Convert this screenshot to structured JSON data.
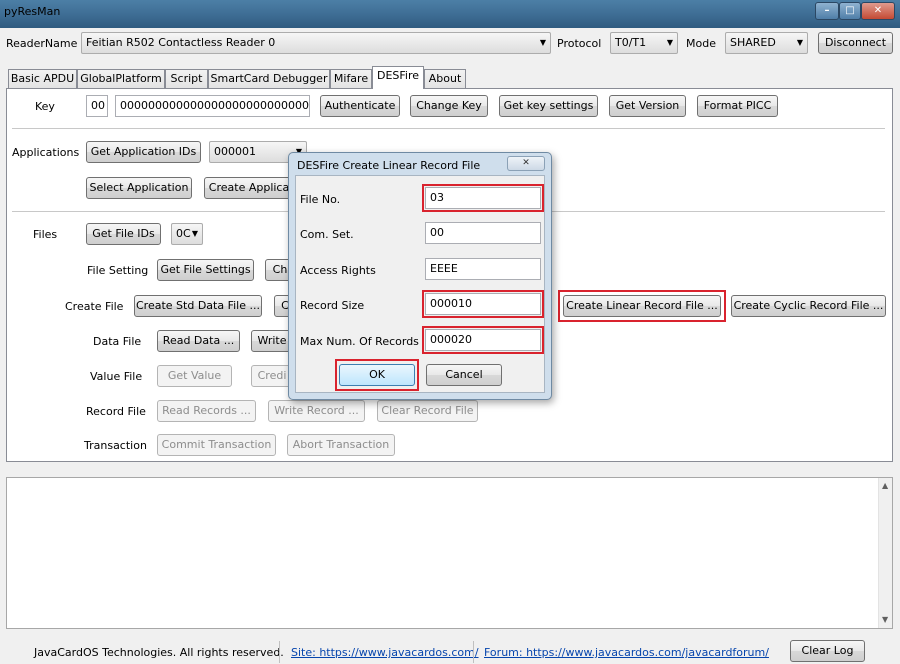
{
  "window": {
    "title": "pyResMan"
  },
  "reader": {
    "label": "ReaderName",
    "value": "Feitian R502 Contactless Reader 0",
    "protocol_label": "Protocol",
    "protocol_value": "T0/T1",
    "mode_label": "Mode",
    "mode_value": "SHARED",
    "disconnect_label": "Disconnect"
  },
  "tabs": [
    "Basic APDU",
    "GlobalPlatform",
    "Script",
    "SmartCard Debugger",
    "Mifare",
    "DESFire",
    "About"
  ],
  "active_tab": "DESFire",
  "key": {
    "label": "Key",
    "number": "00",
    "value": "00000000000000000000000000000000",
    "authenticate": "Authenticate",
    "change_key": "Change Key",
    "get_key_settings": "Get key settings",
    "get_version": "Get Version",
    "format_picc": "Format PICC"
  },
  "applications": {
    "label": "Applications",
    "get_ids": "Get Application IDs",
    "selected_aid": "000001",
    "select": "Select Application",
    "create": "Create Applica"
  },
  "files": {
    "label": "Files",
    "get_file_ids": "Get File IDs",
    "file_id": "0C",
    "file_setting_label": "File Setting",
    "get_file_settings": "Get File Settings",
    "change_partial": "Ch",
    "create_file_label": "Create File",
    "create_std": "Create Std Data File ...",
    "create_partial": "C",
    "create_linear": "Create Linear Record File ...",
    "create_cyclic": "Create Cyclic Record File ...",
    "data_file_label": "Data File",
    "read_data": "Read Data ...",
    "write_partial": "Write",
    "value_file_label": "Value File",
    "get_value": "Get Value",
    "credit_partial": "Credi",
    "record_file_label": "Record File",
    "read_records": "Read Records ...",
    "write_record": "Write Record ...",
    "clear_record": "Clear Record File",
    "transaction_label": "Transaction",
    "commit": "Commit Transaction",
    "abort": "Abort Transaction"
  },
  "dialog": {
    "title": "DESFire Create Linear Record File",
    "close_glyph": "✕",
    "fields": [
      {
        "label": "File No.",
        "value": "03"
      },
      {
        "label": "Com. Set.",
        "value": "00"
      },
      {
        "label": "Access Rights",
        "value": "EEEE"
      },
      {
        "label": "Record Size",
        "value": "000010"
      },
      {
        "label": "Max Num. Of Records",
        "value": "000020"
      }
    ],
    "ok": "OK",
    "cancel": "Cancel"
  },
  "footer": {
    "copyright": "JavaCardOS Technologies. All rights reserved.",
    "site": "Site: https://www.javacardos.com/",
    "forum": "Forum: https://www.javacardos.com/javacardforum/",
    "clear_log": "Clear Log"
  },
  "colors": {
    "highlight": "#d9232e",
    "link": "#0645ad",
    "titlebar": "#3f6e95"
  }
}
